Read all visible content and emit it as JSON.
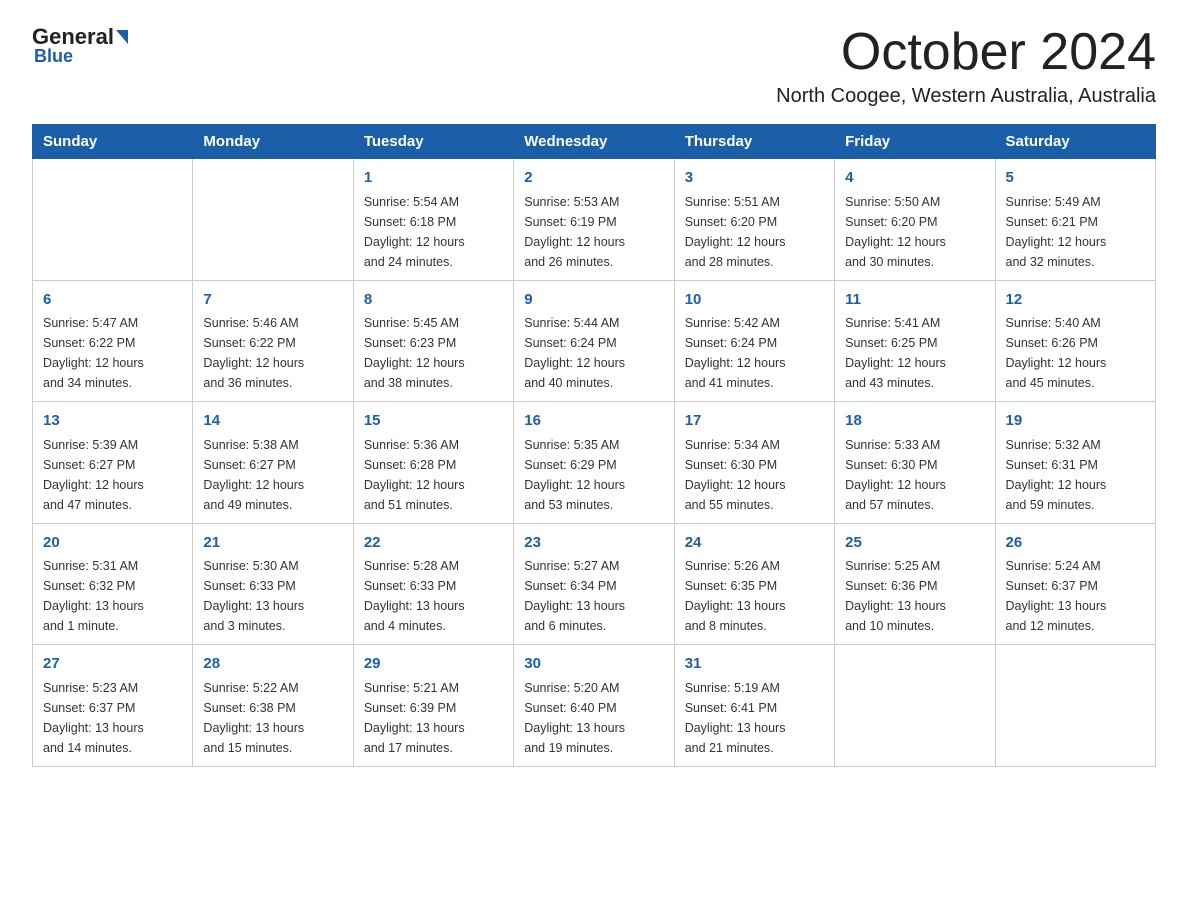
{
  "logo": {
    "text_general": "General",
    "text_blue": "Blue"
  },
  "header": {
    "month": "October 2024",
    "location": "North Coogee, Western Australia, Australia"
  },
  "days_of_week": [
    "Sunday",
    "Monday",
    "Tuesday",
    "Wednesday",
    "Thursday",
    "Friday",
    "Saturday"
  ],
  "weeks": [
    [
      {
        "day": "",
        "info": ""
      },
      {
        "day": "",
        "info": ""
      },
      {
        "day": "1",
        "info": "Sunrise: 5:54 AM\nSunset: 6:18 PM\nDaylight: 12 hours\nand 24 minutes."
      },
      {
        "day": "2",
        "info": "Sunrise: 5:53 AM\nSunset: 6:19 PM\nDaylight: 12 hours\nand 26 minutes."
      },
      {
        "day": "3",
        "info": "Sunrise: 5:51 AM\nSunset: 6:20 PM\nDaylight: 12 hours\nand 28 minutes."
      },
      {
        "day": "4",
        "info": "Sunrise: 5:50 AM\nSunset: 6:20 PM\nDaylight: 12 hours\nand 30 minutes."
      },
      {
        "day": "5",
        "info": "Sunrise: 5:49 AM\nSunset: 6:21 PM\nDaylight: 12 hours\nand 32 minutes."
      }
    ],
    [
      {
        "day": "6",
        "info": "Sunrise: 5:47 AM\nSunset: 6:22 PM\nDaylight: 12 hours\nand 34 minutes."
      },
      {
        "day": "7",
        "info": "Sunrise: 5:46 AM\nSunset: 6:22 PM\nDaylight: 12 hours\nand 36 minutes."
      },
      {
        "day": "8",
        "info": "Sunrise: 5:45 AM\nSunset: 6:23 PM\nDaylight: 12 hours\nand 38 minutes."
      },
      {
        "day": "9",
        "info": "Sunrise: 5:44 AM\nSunset: 6:24 PM\nDaylight: 12 hours\nand 40 minutes."
      },
      {
        "day": "10",
        "info": "Sunrise: 5:42 AM\nSunset: 6:24 PM\nDaylight: 12 hours\nand 41 minutes."
      },
      {
        "day": "11",
        "info": "Sunrise: 5:41 AM\nSunset: 6:25 PM\nDaylight: 12 hours\nand 43 minutes."
      },
      {
        "day": "12",
        "info": "Sunrise: 5:40 AM\nSunset: 6:26 PM\nDaylight: 12 hours\nand 45 minutes."
      }
    ],
    [
      {
        "day": "13",
        "info": "Sunrise: 5:39 AM\nSunset: 6:27 PM\nDaylight: 12 hours\nand 47 minutes."
      },
      {
        "day": "14",
        "info": "Sunrise: 5:38 AM\nSunset: 6:27 PM\nDaylight: 12 hours\nand 49 minutes."
      },
      {
        "day": "15",
        "info": "Sunrise: 5:36 AM\nSunset: 6:28 PM\nDaylight: 12 hours\nand 51 minutes."
      },
      {
        "day": "16",
        "info": "Sunrise: 5:35 AM\nSunset: 6:29 PM\nDaylight: 12 hours\nand 53 minutes."
      },
      {
        "day": "17",
        "info": "Sunrise: 5:34 AM\nSunset: 6:30 PM\nDaylight: 12 hours\nand 55 minutes."
      },
      {
        "day": "18",
        "info": "Sunrise: 5:33 AM\nSunset: 6:30 PM\nDaylight: 12 hours\nand 57 minutes."
      },
      {
        "day": "19",
        "info": "Sunrise: 5:32 AM\nSunset: 6:31 PM\nDaylight: 12 hours\nand 59 minutes."
      }
    ],
    [
      {
        "day": "20",
        "info": "Sunrise: 5:31 AM\nSunset: 6:32 PM\nDaylight: 13 hours\nand 1 minute."
      },
      {
        "day": "21",
        "info": "Sunrise: 5:30 AM\nSunset: 6:33 PM\nDaylight: 13 hours\nand 3 minutes."
      },
      {
        "day": "22",
        "info": "Sunrise: 5:28 AM\nSunset: 6:33 PM\nDaylight: 13 hours\nand 4 minutes."
      },
      {
        "day": "23",
        "info": "Sunrise: 5:27 AM\nSunset: 6:34 PM\nDaylight: 13 hours\nand 6 minutes."
      },
      {
        "day": "24",
        "info": "Sunrise: 5:26 AM\nSunset: 6:35 PM\nDaylight: 13 hours\nand 8 minutes."
      },
      {
        "day": "25",
        "info": "Sunrise: 5:25 AM\nSunset: 6:36 PM\nDaylight: 13 hours\nand 10 minutes."
      },
      {
        "day": "26",
        "info": "Sunrise: 5:24 AM\nSunset: 6:37 PM\nDaylight: 13 hours\nand 12 minutes."
      }
    ],
    [
      {
        "day": "27",
        "info": "Sunrise: 5:23 AM\nSunset: 6:37 PM\nDaylight: 13 hours\nand 14 minutes."
      },
      {
        "day": "28",
        "info": "Sunrise: 5:22 AM\nSunset: 6:38 PM\nDaylight: 13 hours\nand 15 minutes."
      },
      {
        "day": "29",
        "info": "Sunrise: 5:21 AM\nSunset: 6:39 PM\nDaylight: 13 hours\nand 17 minutes."
      },
      {
        "day": "30",
        "info": "Sunrise: 5:20 AM\nSunset: 6:40 PM\nDaylight: 13 hours\nand 19 minutes."
      },
      {
        "day": "31",
        "info": "Sunrise: 5:19 AM\nSunset: 6:41 PM\nDaylight: 13 hours\nand 21 minutes."
      },
      {
        "day": "",
        "info": ""
      },
      {
        "day": "",
        "info": ""
      }
    ]
  ]
}
